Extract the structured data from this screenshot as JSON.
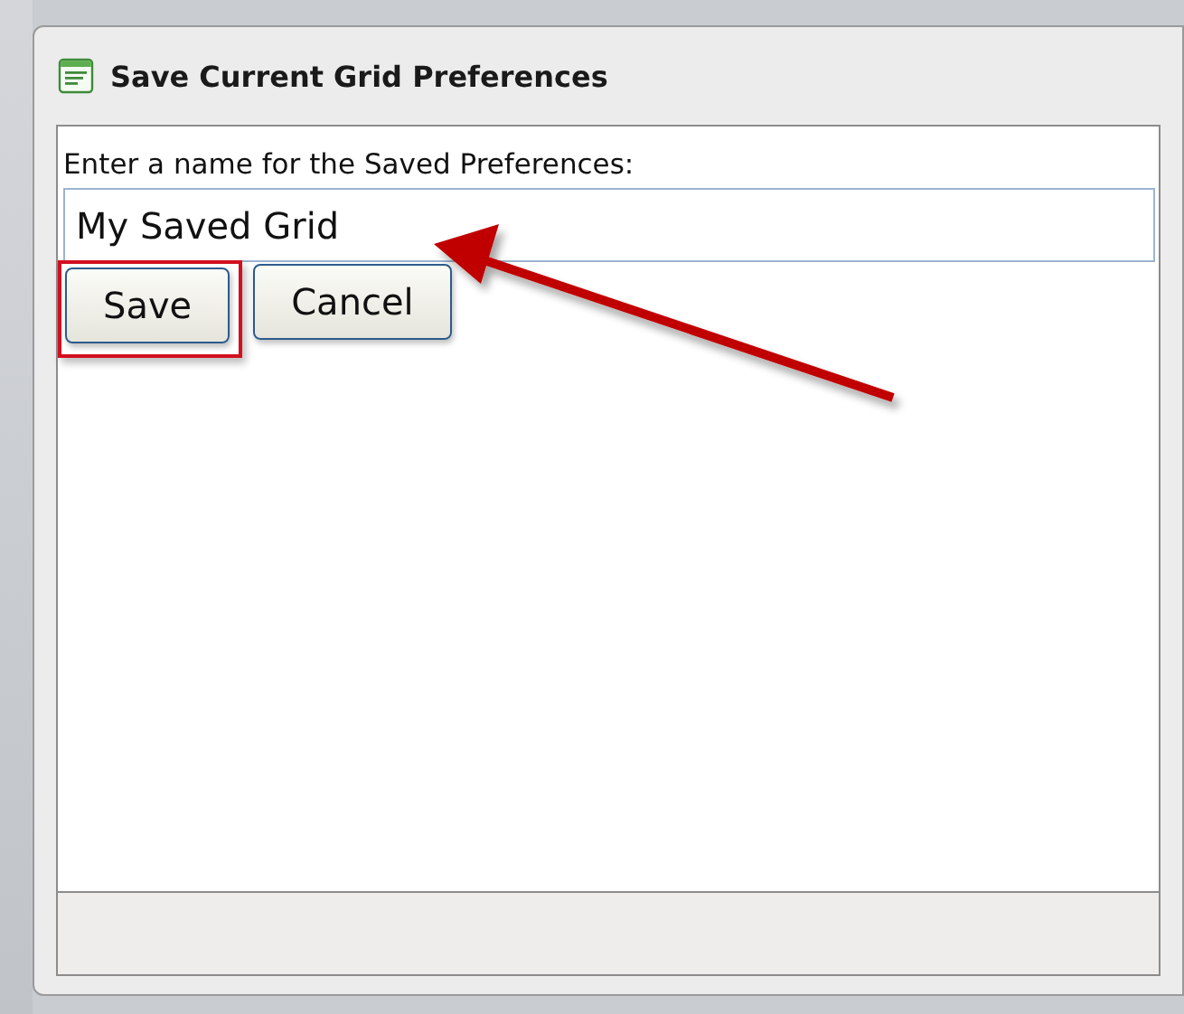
{
  "dialog": {
    "title": "Save Current Grid Preferences",
    "label": "Enter a name for the Saved Preferences:",
    "name_field": {
      "value": "My Saved Grid",
      "pointed_by_arrow": true
    },
    "buttons": [
      {
        "label": "Save",
        "highlighted": true
      },
      {
        "label": "Cancel",
        "highlighted": false
      }
    ]
  }
}
